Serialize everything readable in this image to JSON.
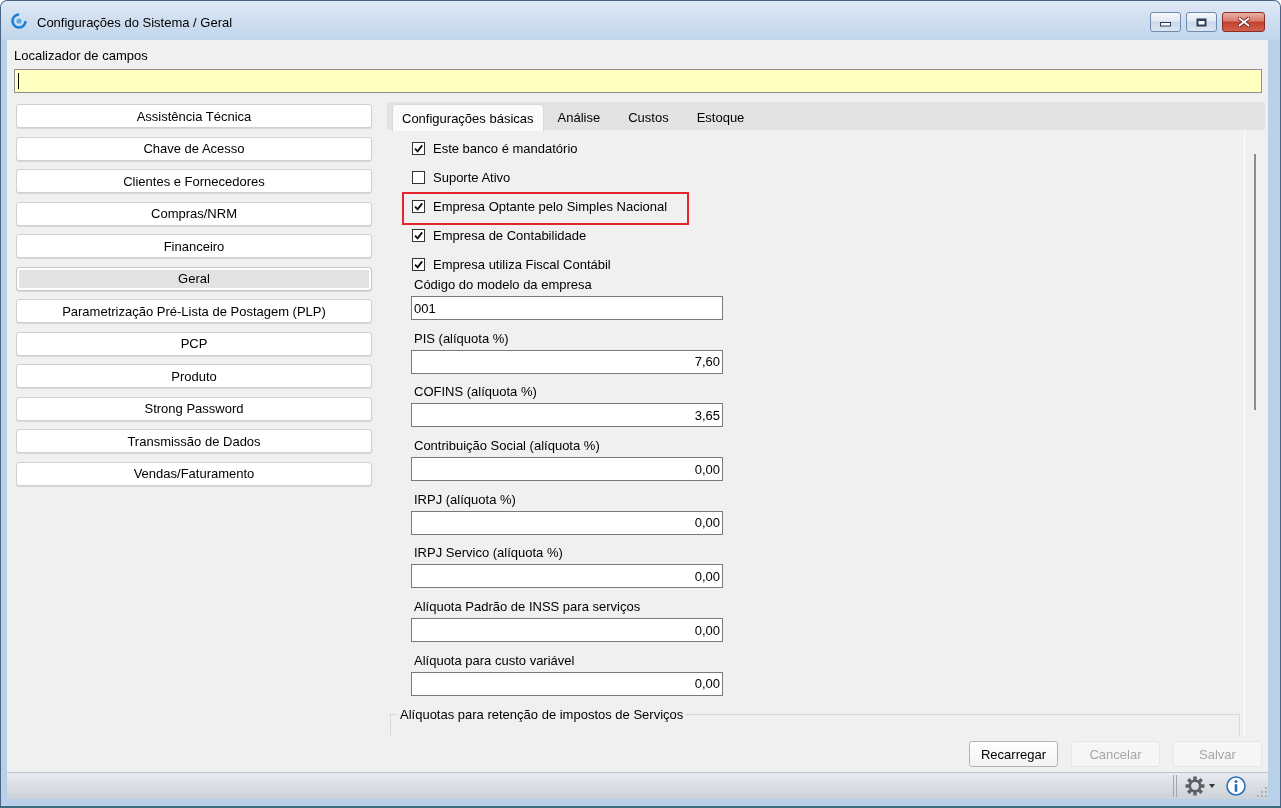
{
  "window": {
    "title": "Configurações do Sistema / Geral"
  },
  "field_locator": {
    "label": "Localizador de campos",
    "focused": true
  },
  "sidebar": {
    "items": [
      {
        "label": "Assistência Técnica",
        "selected": false
      },
      {
        "label": "Chave de Acesso",
        "selected": false
      },
      {
        "label": "Clientes e Fornecedores",
        "selected": false
      },
      {
        "label": "Compras/NRM",
        "selected": false
      },
      {
        "label": "Financeiro",
        "selected": false
      },
      {
        "label": "Geral",
        "selected": true
      },
      {
        "label": "Parametrização Pré-Lista de Postagem (PLP)",
        "selected": false
      },
      {
        "label": "PCP",
        "selected": false
      },
      {
        "label": "Produto",
        "selected": false
      },
      {
        "label": "Strong Password",
        "selected": false
      },
      {
        "label": "Transmissão de Dados",
        "selected": false
      },
      {
        "label": "Vendas/Faturamento",
        "selected": false
      }
    ]
  },
  "tabs": [
    {
      "label": "Configurações básicas",
      "selected": true
    },
    {
      "label": "Análise",
      "selected": false
    },
    {
      "label": "Custos",
      "selected": false
    },
    {
      "label": "Estoque",
      "selected": false
    }
  ],
  "settings": {
    "checkboxes": [
      {
        "label": "Este banco é mandatório",
        "checked": true,
        "highlighted": false
      },
      {
        "label": "Suporte Ativo",
        "checked": false,
        "highlighted": false
      },
      {
        "label": "Empresa Optante pelo Simples Nacional",
        "checked": true,
        "highlighted": true
      },
      {
        "label": "Empresa de Contabilidade",
        "checked": true,
        "highlighted": false
      },
      {
        "label": "Empresa utiliza Fiscal Contábil",
        "checked": true,
        "highlighted": false
      }
    ],
    "fields": [
      {
        "label": "Código do modelo da empresa",
        "value": "001",
        "kind": "text"
      },
      {
        "label": "PIS (alíquota %)",
        "value": "7,60",
        "kind": "number"
      },
      {
        "label": "COFINS (alíquota %)",
        "value": "3,65",
        "kind": "number"
      },
      {
        "label": "Contribuição Social (alíquota %)",
        "value": "0,00",
        "kind": "number"
      },
      {
        "label": "IRPJ (alíquota %)",
        "value": "0,00",
        "kind": "number"
      },
      {
        "label": "IRPJ Servico (alíquota %)",
        "value": "0,00",
        "kind": "number"
      },
      {
        "label": "Alíquota Padrão de INSS para serviços",
        "value": "0,00",
        "kind": "number"
      },
      {
        "label": "Alíquota para custo variável",
        "value": "0,00",
        "kind": "number"
      }
    ],
    "group_box": {
      "title": "Alíquotas para retenção de impostos de Serviços"
    }
  },
  "buttons": [
    {
      "label": "Recarregar",
      "disabled": false
    },
    {
      "label": "Cancelar",
      "disabled": true
    },
    {
      "label": "Salvar",
      "disabled": true
    }
  ]
}
